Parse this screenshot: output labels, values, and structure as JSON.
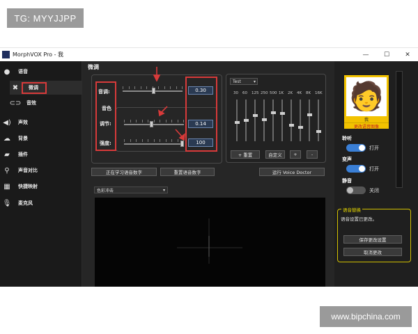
{
  "watermarks": {
    "top_left": "TG: MYYJJPP",
    "bottom_right": "www.bipchina.com"
  },
  "window": {
    "title": "MorphVOX Pro - 我",
    "controls": {
      "minimize": "—",
      "maximize": "☐",
      "close": "✕"
    }
  },
  "sidebar": {
    "items": [
      {
        "label": "语音",
        "icon": "voice-icon"
      },
      {
        "label": "微调",
        "icon": "tools-icon"
      },
      {
        "label": "音效",
        "icon": "effects-icon"
      },
      {
        "label": "声效",
        "icon": "speaker-icon"
      },
      {
        "label": "背景",
        "icon": "cloud-icon"
      },
      {
        "label": "插件",
        "icon": "plugin-icon"
      },
      {
        "label": "声音对比",
        "icon": "compare-icon"
      },
      {
        "label": "快捷映射",
        "icon": "keyboard-icon"
      },
      {
        "label": "麦克风",
        "icon": "microphone-icon"
      }
    ],
    "active_index": 1
  },
  "tweak": {
    "title": "微调",
    "pitch": {
      "label": "音调:",
      "value": "0.30",
      "level": 0.52
    },
    "timbre_group": "音色",
    "strength": {
      "label": "调节:",
      "value": "0.14",
      "level": 0.46
    },
    "tone": {
      "label": "强度:",
      "value": "100",
      "level": 1.0
    }
  },
  "buttons": {
    "learn": "正在学习语音数字",
    "reset_learn": "重置语音数字",
    "voice_doctor": "运行 Voice Doctor"
  },
  "equalizer": {
    "preset": "Test",
    "bands": [
      "30",
      "60",
      "125",
      "250",
      "500",
      "1K",
      "2K",
      "4K",
      "8K",
      "16K"
    ],
    "levels": [
      0.55,
      0.5,
      0.38,
      0.48,
      0.3,
      0.32,
      0.62,
      0.68,
      0.36,
      0.78
    ],
    "buttons": {
      "add": "+ 重置",
      "custom": "自定义",
      "plus": "+",
      "minus": "-"
    }
  },
  "visualizer": {
    "mode": "色彩冲击"
  },
  "avatar": {
    "name": "我",
    "link": "更改语音图像",
    "emoji": "🧑"
  },
  "toggles": [
    {
      "label": "聆听",
      "state": "打开",
      "on": true
    },
    {
      "label": "变声",
      "state": "打开",
      "on": true
    },
    {
      "label": "静音",
      "state": "关闭",
      "on": false
    }
  ],
  "voice_change": {
    "title": "语音替换",
    "message": "语音设置已更改。",
    "save_button": "保存更改设置",
    "cancel_button": "取消更改"
  },
  "colors": {
    "background": "#1e1e1e",
    "annotation_red": "#d83a3a",
    "toggle_on": "#3a7fd6",
    "toggle_off": "#555555",
    "accent_yellow": "#f2c200"
  }
}
